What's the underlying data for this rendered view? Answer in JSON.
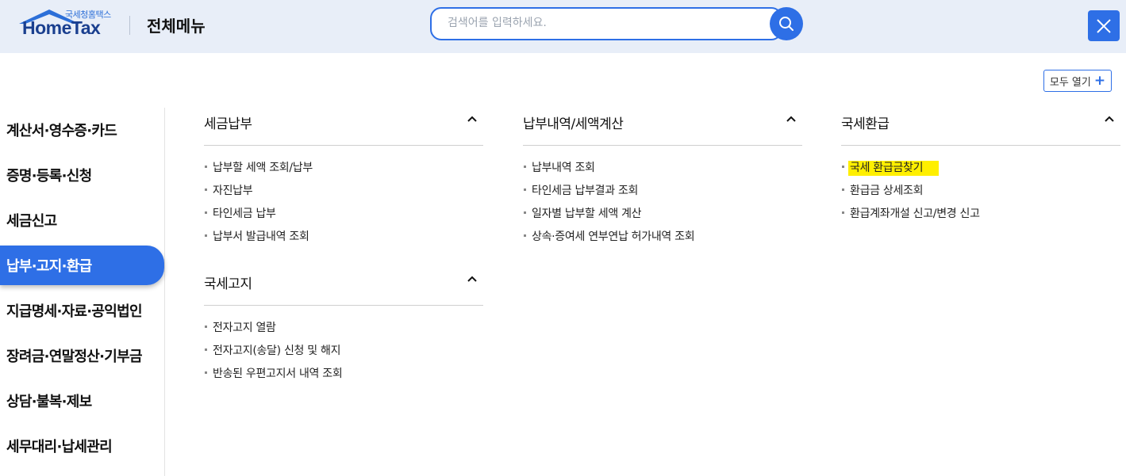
{
  "header": {
    "logo_small": "국세청홈택스",
    "logo_main": "HomeTax",
    "title": "전체메뉴",
    "search_placeholder": "검색어를 입력하세요.",
    "search_value": ""
  },
  "toolbar": {
    "open_all_label": "모두 열기",
    "open_all_icon": "+"
  },
  "sidebar": {
    "active_index": 3,
    "items": [
      {
        "label": "계산서·영수증·카드"
      },
      {
        "label": "증명·등록·신청"
      },
      {
        "label": "세금신고"
      },
      {
        "label": "납부·고지·환급"
      },
      {
        "label": "지급명세·자료·공익법인"
      },
      {
        "label": "장려금·연말정산·기부금"
      },
      {
        "label": "상담·불복·제보"
      },
      {
        "label": "세무대리·납세관리"
      }
    ]
  },
  "sections": {
    "tax_payment": {
      "title": "세금납부",
      "links": [
        "납부할 세액 조회/납부",
        "자진납부",
        "타인세금 납부",
        "납부서 발급내역 조회"
      ]
    },
    "national_notice": {
      "title": "국세고지",
      "links": [
        "전자고지 열람",
        "전자고지(송달) 신청 및 해지",
        "반송된 우편고지서 내역 조회"
      ]
    },
    "payment_history": {
      "title": "납부내역/세액계산",
      "links": [
        "납부내역 조회",
        "타인세금 납부결과 조회",
        "일자별 납부할 세액 계산",
        "상속·증여세 연부연납 허가내역 조회"
      ]
    },
    "tax_refund": {
      "title": "국세환급",
      "links": [
        "국세 환급금찾기",
        "환급금 상세조회",
        "환급계좌개설 신고/변경 신고"
      ],
      "highlighted_index": 0
    }
  },
  "colors": {
    "accent": "#2e6fe6",
    "header_bg": "#e8eef8",
    "highlight": "#ffef00"
  },
  "icons": {
    "search": "search-icon",
    "close": "close-icon",
    "collapse": "chevron-up-icon",
    "logo_roof": "house-roof-icon"
  }
}
